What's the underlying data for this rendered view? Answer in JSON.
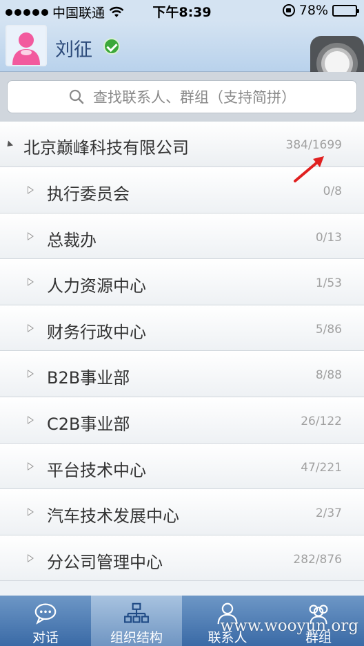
{
  "status_bar": {
    "carrier": "中国联通",
    "time": "下午8:39",
    "battery_percent": "78%",
    "battery_level": 0.78
  },
  "header": {
    "user_name": "刘征",
    "status": "online"
  },
  "search": {
    "placeholder": "查找联系人、群组（支持简拼）"
  },
  "org": {
    "company_name": "北京巅峰科技有限公司",
    "company_count": "384/1699",
    "departments": [
      {
        "name": "执行委员会",
        "count": "0/8"
      },
      {
        "name": "总裁办",
        "count": "0/13"
      },
      {
        "name": "人力资源中心",
        "count": "1/53"
      },
      {
        "name": "财务行政中心",
        "count": "5/86"
      },
      {
        "name": "B2B事业部",
        "count": "8/88"
      },
      {
        "name": "C2B事业部",
        "count": "26/122"
      },
      {
        "name": "平台技术中心",
        "count": "47/221"
      },
      {
        "name": "汽车技术发展中心",
        "count": "2/37"
      },
      {
        "name": "分公司管理中心",
        "count": "282/876"
      }
    ]
  },
  "tabs": [
    {
      "label": "对话",
      "icon": "chat-icon",
      "active": false
    },
    {
      "label": "组织结构",
      "icon": "org-chart-icon",
      "active": true
    },
    {
      "label": "联系人",
      "icon": "contact-icon",
      "active": false
    },
    {
      "label": "群组",
      "icon": "group-icon",
      "active": false
    }
  ],
  "watermark": "www.wooyun.org",
  "colors": {
    "header_bg": "#c3d9f0",
    "tabbar_bg": "#4a78b2",
    "annotation": "#e02020",
    "online": "#3ca83a"
  }
}
